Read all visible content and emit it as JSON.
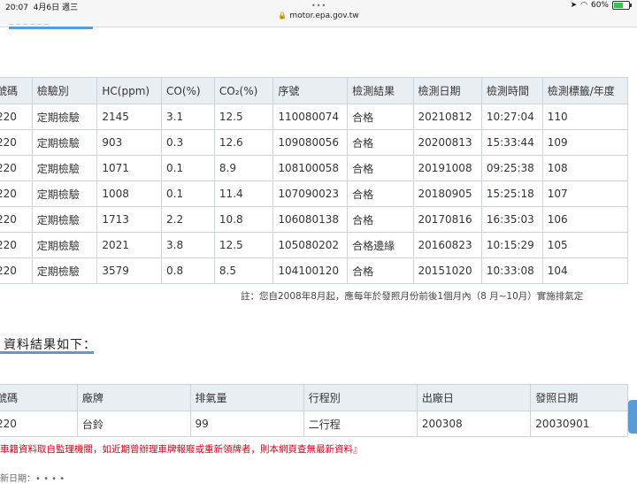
{
  "status": {
    "time": "20:07",
    "date": "4月6日 週三",
    "url": "motor.epa.gov.tw",
    "battery": "60%",
    "battery_level": 0.6
  },
  "table1": {
    "headers": [
      "號碼",
      "檢驗別",
      "HC(ppm)",
      "CO(%)",
      "CO₂(%)",
      "序號",
      "檢測結果",
      "檢測日期",
      "檢測時間",
      "檢測標籤/年度"
    ],
    "rows": [
      [
        "220",
        "定期檢驗",
        "2145",
        "3.1",
        "12.5",
        "110080074",
        "合格",
        "20210812",
        "10:27:04",
        "110"
      ],
      [
        "220",
        "定期檢驗",
        "903",
        "0.3",
        "12.6",
        "109080056",
        "合格",
        "20200813",
        "15:33:44",
        "109"
      ],
      [
        "220",
        "定期檢驗",
        "1071",
        "0.1",
        "8.9",
        "108100058",
        "合格",
        "20191008",
        "09:25:38",
        "108"
      ],
      [
        "220",
        "定期檢驗",
        "1008",
        "0.1",
        "11.4",
        "107090023",
        "合格",
        "20180905",
        "15:25:18",
        "107"
      ],
      [
        "220",
        "定期檢驗",
        "1713",
        "2.2",
        "10.8",
        "106080138",
        "合格",
        "20170816",
        "16:35:03",
        "106"
      ],
      [
        "220",
        "定期檢驗",
        "2021",
        "3.8",
        "12.5",
        "105080202",
        "合格邊緣",
        "20160823",
        "10:15:29",
        "105"
      ],
      [
        "220",
        "定期檢驗",
        "3579",
        "0.8",
        "8.5",
        "104100120",
        "合格",
        "20151020",
        "10:33:08",
        "104"
      ]
    ]
  },
  "note1": "註：您自2008年8月起，應每年於發照月份前後1個月內（8 月~10月）實施排氣定",
  "section_title": "資料結果如下：",
  "table2": {
    "headers": [
      "號碼",
      "廠牌",
      "排氣量",
      "行程別",
      "出廠日",
      "發照日期"
    ],
    "rows": [
      [
        "220",
        "台鈴",
        "99",
        "二行程",
        "200308",
        "20030901"
      ]
    ]
  },
  "note2": "車籍資料取自監理機關，如近期曾辦理車牌報廢或重新領牌者，則本網頁查無最新資料』",
  "colors": {
    "accent": "#5b9bd5",
    "header_bg": "#e9eef3",
    "warning": "#d0021b"
  }
}
